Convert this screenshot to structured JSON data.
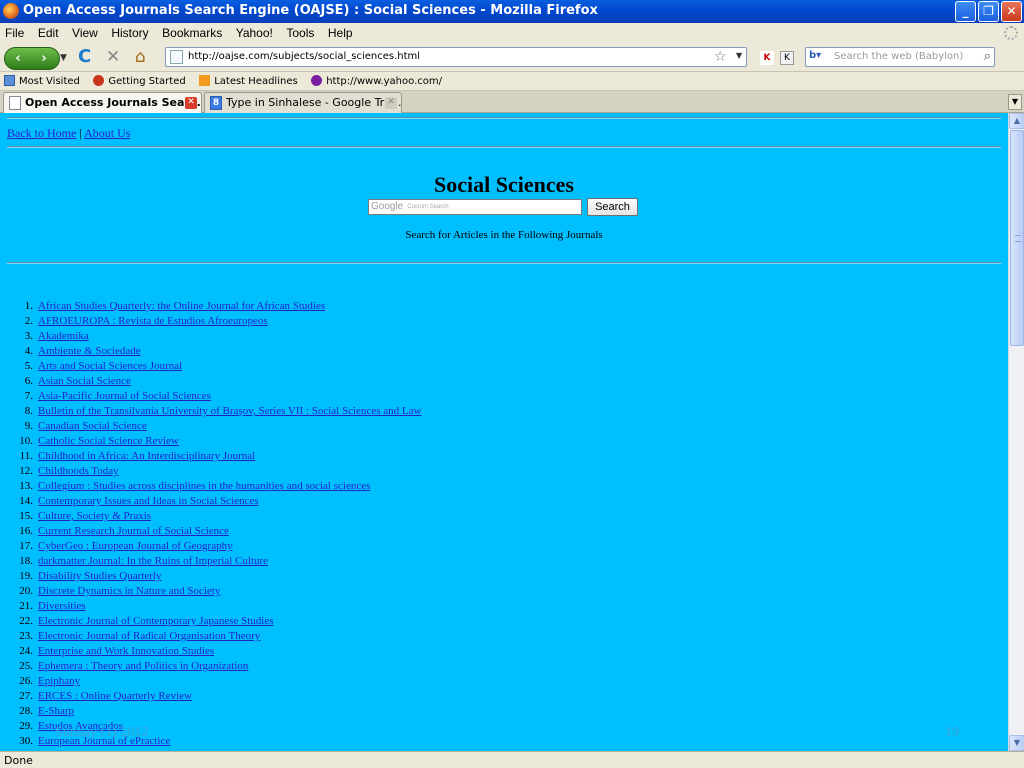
{
  "window": {
    "title": "Open Access Journals Search Engine (OAJSE) : Social Sciences - Mozilla Firefox",
    "minimize_glyph": "_",
    "maximize_glyph": "❐",
    "close_glyph": "✕"
  },
  "menu": [
    "File",
    "Edit",
    "View",
    "History",
    "Bookmarks",
    "Yahoo!",
    "Tools",
    "Help"
  ],
  "nav": {
    "back_glyph": "‹",
    "forward_glyph": "›",
    "reload_glyph": "C",
    "stop_glyph": "✕",
    "home_glyph": "⌂",
    "url": "http://oajse.com/subjects/social_sciences.html",
    "search_placeholder": "Search the web (Babylon)"
  },
  "bookmarks": [
    {
      "label": "Most Visited",
      "icon": "most-visited-icon"
    },
    {
      "label": "Getting Started",
      "icon": "firefox-icon"
    },
    {
      "label": "Latest Headlines",
      "icon": "rss-icon"
    },
    {
      "label": "http://www.yahoo.com/",
      "icon": "yahoo-icon"
    }
  ],
  "tabs": [
    {
      "label": "Open Access Journals Sear...",
      "active": true
    },
    {
      "label": "Type in Sinhalese - Google Tra...",
      "active": false
    }
  ],
  "page": {
    "nav_links": {
      "home": "Back to Home",
      "separator": "|",
      "about": "About Us"
    },
    "heading": "Social Sciences",
    "search_brand": "Google",
    "search_hint": "Custom Search",
    "search_button": "Search",
    "caption": "Search for Articles in the Following Journals",
    "watermark_date": "Sunday (1) 2012",
    "watermark_page": "19"
  },
  "journals": [
    "African Studies Quarterly: the Online Journal for African Studies",
    "AFROEUROPA : Revista de Estudios Afroeuropeos",
    "Akademika",
    "Ambiente & Sociedade",
    "Arts and Social Sciences Journal",
    "Asian Social Science",
    "Asia-Pacific Journal of Social Sciences",
    "Bulletin of the Transilvania University of Brașov, Series VII : Social Sciences and Law",
    "Canadian Social Science",
    "Catholic Social Science Review",
    "Childhood in Africa: An Interdisciplinary Journal",
    "Childhoods Today",
    "Collegium : Studies across disciplines in the humanities and social sciences",
    "Contemporary Issues and Ideas in Social Sciences",
    "Culture, Society & Praxis",
    "Current Research Journal of Social Science",
    "CyberGeo : European Journal of Geography",
    "darkmatter Journal: In the Ruins of Imperial Culture",
    "Disability Studies Quarterly",
    "Discrete Dynamics in Nature and Society",
    "Diversities",
    "Electronic Journal of Contemporary Japanese Studies",
    "Electronic Journal of Radical Organisation Theory",
    "Enterprise and Work Innovation Studies",
    "Ephemera : Theory and Politics in Organization",
    "Epiphany",
    "ERCES : Online Quarterly Review",
    "E-Sharp",
    "Estudos Avançados",
    "European Journal of ePractice"
  ],
  "status": {
    "text": "Done"
  }
}
